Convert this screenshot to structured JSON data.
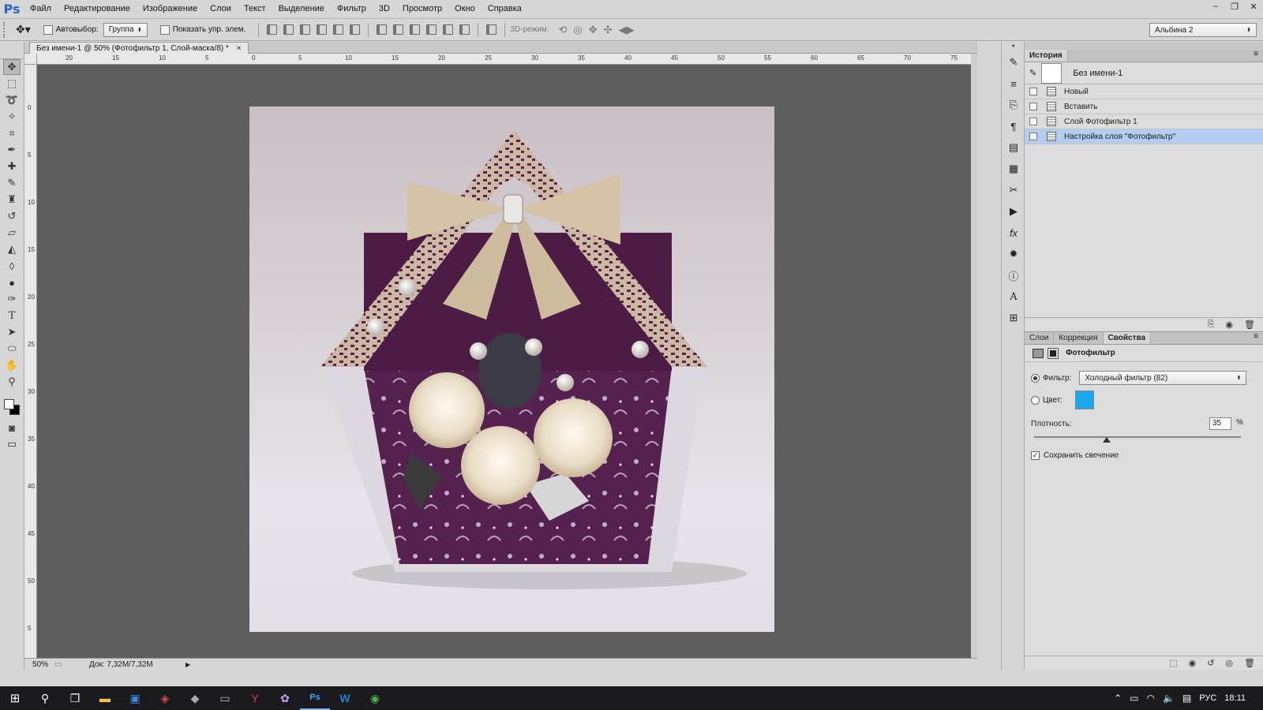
{
  "menubar": {
    "logo": "Ps",
    "items": [
      "Файл",
      "Редактирование",
      "Изображение",
      "Слои",
      "Текст",
      "Выделение",
      "Фильтр",
      "3D",
      "Просмотр",
      "Окно",
      "Справка"
    ]
  },
  "options": {
    "autoselect_label": "Автовыбор:",
    "autoselect_value": "Группа",
    "show_controls_label": "Показать упр. элем.",
    "mode3d_label": "3D-режим:",
    "workspace": "Альбина 2"
  },
  "document": {
    "tab_title": "Без имени-1 @ 50% (Фотофильтр 1, Слой-маска/8) *",
    "close_glyph": "×",
    "zoom": "50%",
    "doc_info": "Док: 7,32M/7,32M",
    "ruler_h": [
      "20",
      "15",
      "10",
      "5",
      "0",
      "5",
      "10",
      "15",
      "20",
      "25",
      "30",
      "35",
      "40",
      "45",
      "50",
      "55",
      "60",
      "65",
      "70",
      "75"
    ],
    "ruler_v": [
      "0",
      "5",
      "10",
      "15",
      "20",
      "25",
      "30",
      "35",
      "40",
      "45",
      "50",
      "5"
    ]
  },
  "history": {
    "tab": "История",
    "snapshot": "Без имени-1",
    "items": [
      "Новый",
      "Вставить",
      "Слой Фотофильтр 1",
      "Настройка слоя \"Фотофильтр\""
    ]
  },
  "properties": {
    "tabs": [
      "Слои",
      "Коррекция",
      "Свойства"
    ],
    "title": "Фотофильтр",
    "filter_label": "Фильтр:",
    "filter_value": "Холодный фильтр (82)",
    "color_label": "Цвет:",
    "color_swatch": "#1aa7ef",
    "density_label": "Плотность:",
    "density_value": "35",
    "density_unit": "%",
    "density": 35,
    "preserve_label": "Сохранить свечение"
  },
  "taskbar": {
    "lang": "РУС",
    "time": "18:11"
  },
  "icons": {
    "accent": "#2b64c8",
    "selection": "#b3cdf0"
  }
}
